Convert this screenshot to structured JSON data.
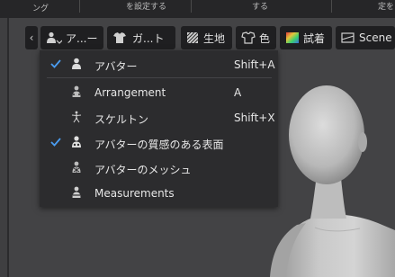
{
  "top_strip": {
    "fragment_1": "ング",
    "fragment_2": "を設定する",
    "fragment_3": "する",
    "fragment_4": "定を"
  },
  "toolbar": {
    "chevron": "‹",
    "buttons": [
      {
        "label": "ア...ー",
        "icon": "avatar-icon",
        "has_dropdown": true
      },
      {
        "label": "ガ...ト",
        "icon": "garment-icon",
        "has_dropdown": true
      },
      {
        "label": "生地",
        "icon": "fabric-icon"
      },
      {
        "label": "色",
        "icon": "color-icon"
      },
      {
        "label": "試着",
        "icon": "fitting-icon"
      },
      {
        "label": "Scene",
        "icon": "scene-icon"
      }
    ]
  },
  "menu": {
    "items": [
      {
        "label": "アバター",
        "shortcut": "Shift+A",
        "checked": true,
        "icon": "avatar-icon"
      },
      {
        "label": "Arrangement",
        "shortcut": "A",
        "checked": false,
        "icon": "arrangement-icon"
      },
      {
        "label": "スケルトン",
        "shortcut": "Shift+X",
        "checked": false,
        "icon": "skeleton-icon"
      },
      {
        "label": "アバターの質感のある表面",
        "shortcut": "",
        "checked": true,
        "icon": "textured-surface-icon"
      },
      {
        "label": "アバターのメッシュ",
        "shortcut": "",
        "checked": false,
        "icon": "avatar-mesh-icon"
      },
      {
        "label": "Measurements",
        "shortcut": "",
        "checked": false,
        "icon": "measurements-icon"
      }
    ]
  },
  "colors": {
    "accent_check": "#4a9cf0",
    "menu_bg": "#2c2c2e",
    "toolbar_bg": "#1f1f21",
    "viewport_bg": "#434345"
  }
}
